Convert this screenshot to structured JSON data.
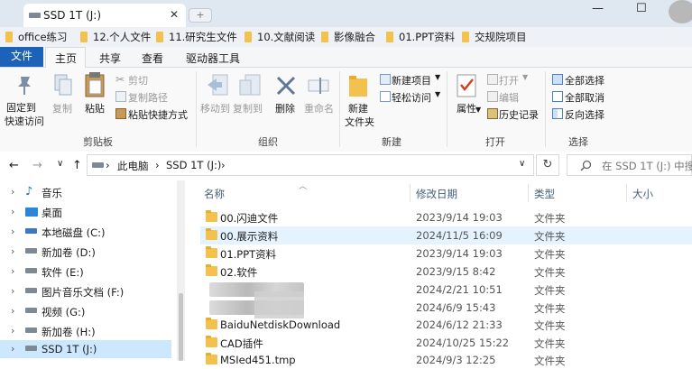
{
  "window": {
    "tab_title": "SSD 1T (J:)",
    "close_glyph": "✕",
    "new_tab_glyph": "+",
    "minimize_glyph": "—",
    "maximize_glyph": "☐",
    "drive_icon": "drive-icon"
  },
  "bookmarks": [
    "office练习",
    "12.个人文件",
    "11.研究生文件",
    "10.文献阅读",
    "影像融合",
    "01.PPT资料",
    "交规院项目"
  ],
  "ribbon_tabs": {
    "file": "文件",
    "items": [
      "主页",
      "共享",
      "查看",
      "驱动器工具"
    ]
  },
  "ribbon": {
    "clipboard": {
      "pin": "固定到",
      "pin2": "快速访问",
      "copy": "复制",
      "paste": "粘贴",
      "cut": "剪切",
      "copy_path": "复制路径",
      "paste_shortcut": "粘贴快捷方式",
      "group": "剪贴板"
    },
    "organize": {
      "move_to": "移动到",
      "copy_to": "复制到",
      "delete": "删除",
      "rename": "重命名",
      "group": "组织"
    },
    "new": {
      "new_folder": "新建",
      "new_folder2": "文件夹",
      "new_item": "新建项目",
      "easy_access": "轻松访问",
      "group": "新建"
    },
    "open": {
      "properties": "属性",
      "open": "打开",
      "edit": "编辑",
      "history": "历史记录",
      "group": "打开"
    },
    "select": {
      "select_all": "全部选择",
      "select_none": "全部取消",
      "invert": "反向选择",
      "group": "选择"
    }
  },
  "address": {
    "back": "←",
    "forward": "→",
    "recent": "∨",
    "up": "↑",
    "crumbs": [
      "此电脑",
      "SSD 1T (J:)"
    ],
    "sep": "›",
    "dropdown": "∨",
    "refresh": "↻",
    "search_placeholder": "在 SSD 1T (J:) 中搜"
  },
  "nav": [
    {
      "label": "音乐",
      "icon": "music-icon"
    },
    {
      "label": "桌面",
      "icon": "desktop-icon"
    },
    {
      "label": "本地磁盘 (C:)",
      "icon": "drive-icon"
    },
    {
      "label": "新加卷 (D:)",
      "icon": "drive-icon"
    },
    {
      "label": "软件 (E:)",
      "icon": "drive-icon"
    },
    {
      "label": "图片音乐文档 (F:)",
      "icon": "drive-icon"
    },
    {
      "label": "视频 (G:)",
      "icon": "drive-icon"
    },
    {
      "label": "新加卷 (H:)",
      "icon": "drive-icon"
    },
    {
      "label": "SSD 1T (J:)",
      "icon": "drive-icon",
      "selected": true
    }
  ],
  "columns": {
    "name": "名称",
    "date": "修改日期",
    "type": "类型",
    "size": "大小"
  },
  "files": [
    {
      "name": "00.闪迪文件",
      "date": "2023/9/14 19:03",
      "type": "文件夹"
    },
    {
      "name": "00.展示资料",
      "date": "2024/11/5 16:09",
      "type": "文件夹",
      "highlight": true
    },
    {
      "name": "01.PPT资料",
      "date": "2023/9/14 19:03",
      "type": "文件夹"
    },
    {
      "name": "02.软件",
      "date": "2023/9/15 8:42",
      "type": "文件夹"
    },
    {
      "name": "",
      "date": "2024/2/21 10:51",
      "type": "文件夹",
      "blurred": true
    },
    {
      "name": "",
      "date": "2024/6/9 15:43",
      "type": "文件夹",
      "blurred": true
    },
    {
      "name": "BaiduNetdiskDownload",
      "date": "2024/6/12 21:33",
      "type": "文件夹"
    },
    {
      "name": "CAD插件",
      "date": "2024/10/25 15:22",
      "type": "文件夹"
    },
    {
      "name": "MSIed451.tmp",
      "date": "2024/9/3 12:25",
      "type": "文件夹"
    }
  ]
}
